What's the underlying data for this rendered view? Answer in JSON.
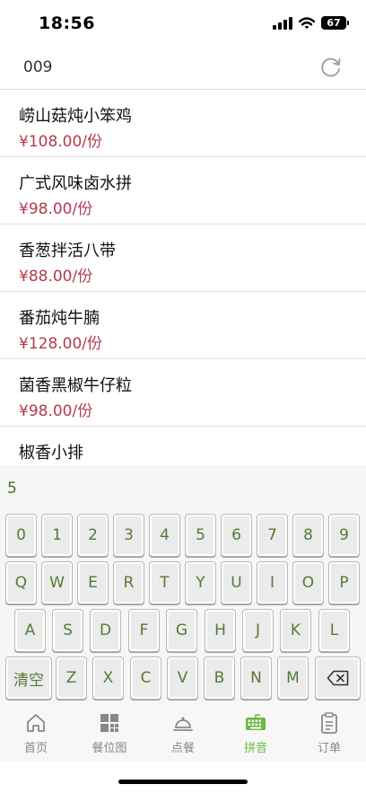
{
  "status": {
    "time": "18:56",
    "battery": "67"
  },
  "header": {
    "table_no": "009"
  },
  "menu": [
    {
      "name": "崂山菇炖小笨鸡",
      "price": "¥108.00/份"
    },
    {
      "name": "广式风味卤水拼",
      "price": "¥98.00/份"
    },
    {
      "name": "香葱拌活八带",
      "price": "¥88.00/份"
    },
    {
      "name": "番茄炖牛腩",
      "price": "¥128.00/份"
    },
    {
      "name": "菌香黑椒牛仔粒",
      "price": "¥98.00/份"
    },
    {
      "name": "椒香小排",
      "price": ""
    }
  ],
  "keyboard": {
    "input_value": "5",
    "row1": [
      "0",
      "1",
      "2",
      "3",
      "4",
      "5",
      "6",
      "7",
      "8",
      "9"
    ],
    "row2": [
      "Q",
      "W",
      "E",
      "R",
      "T",
      "Y",
      "U",
      "I",
      "O",
      "P"
    ],
    "row3": [
      "A",
      "S",
      "D",
      "F",
      "G",
      "H",
      "J",
      "K",
      "L"
    ],
    "row4": [
      "Z",
      "X",
      "C",
      "V",
      "B",
      "N",
      "M"
    ],
    "clear_label": "清空",
    "backspace_icon": "backspace-icon"
  },
  "tabs": [
    {
      "label": "首页",
      "icon": "home-icon"
    },
    {
      "label": "餐位图",
      "icon": "grid-icon"
    },
    {
      "label": "点餐",
      "icon": "service-bell-icon"
    },
    {
      "label": "拼音",
      "icon": "keyboard-icon",
      "active": true
    },
    {
      "label": "订单",
      "icon": "clipboard-icon"
    }
  ],
  "colors": {
    "accent": "#6bb842",
    "price": "#b33a4e",
    "key_text": "#557a34"
  }
}
